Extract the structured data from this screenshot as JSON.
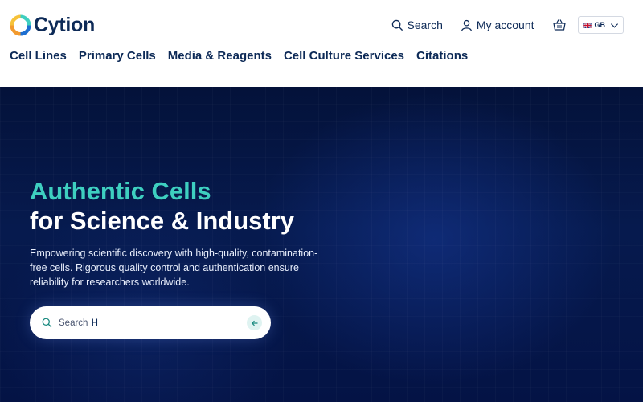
{
  "brand": {
    "name": "Cytion",
    "colors": {
      "navy": "#0d2a57",
      "teal": "#3ecfc0",
      "orange": "#f29a2e"
    }
  },
  "utility": {
    "search_label": "Search",
    "account_label": "My account",
    "basket_icon": "basket-icon",
    "language": {
      "code": "GB",
      "flag_icon": "uk-flag-icon"
    }
  },
  "nav": {
    "items": [
      "Cell Lines",
      "Primary Cells",
      "Media & Reagents",
      "Cell Culture Services",
      "Citations"
    ]
  },
  "hero": {
    "title_accent": "Authentic Cells",
    "title_main": "for Science & Industry",
    "description": "Empowering scientific discovery with high-quality, contamination-free cells. Rigorous quality control and authentication ensure reliability for researchers worldwide.",
    "search": {
      "label": "Search",
      "value": "H"
    }
  }
}
